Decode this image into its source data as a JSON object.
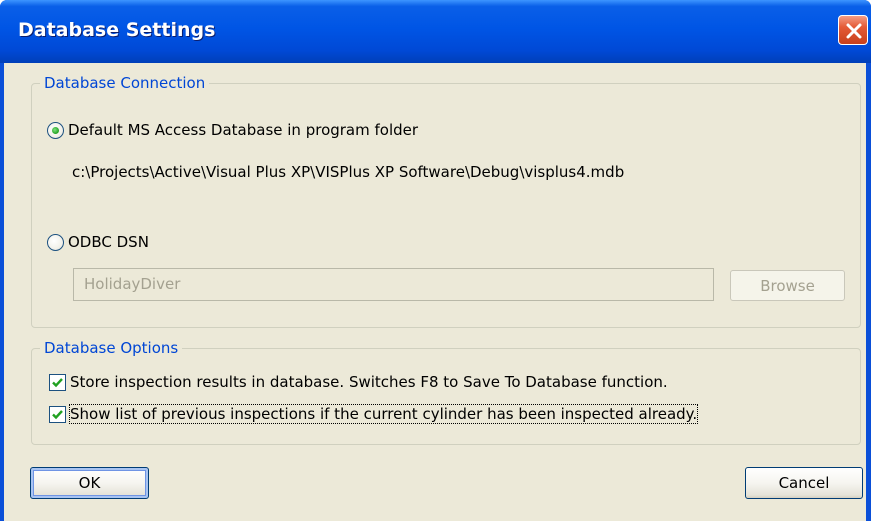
{
  "window": {
    "title": "Database Settings"
  },
  "connection": {
    "group_title": "Database Connection",
    "default_option_label": "Default MS Access Database in program folder",
    "default_path": "c:\\Projects\\Active\\Visual Plus XP\\VISPlus XP Software\\Debug\\visplus4.mdb",
    "odbc_option_label": "ODBC DSN",
    "dsn_value": "HolidayDiver",
    "browse_label": "Browse",
    "selected": "default"
  },
  "options": {
    "group_title": "Database Options",
    "store_results_label": "Store inspection results in database. Switches F8 to Save To Database function.",
    "store_results_checked": true,
    "show_list_label": "Show list of previous inspections if the current cylinder has been inspected already.",
    "show_list_checked": true
  },
  "buttons": {
    "ok_label": "OK",
    "cancel_label": "Cancel"
  },
  "colors": {
    "titlebar": "#0055e5",
    "group_title": "#0046d5",
    "dialog_bg": "#ece9d8"
  },
  "icons": {
    "close": "close-icon",
    "check": "checkmark-icon"
  }
}
